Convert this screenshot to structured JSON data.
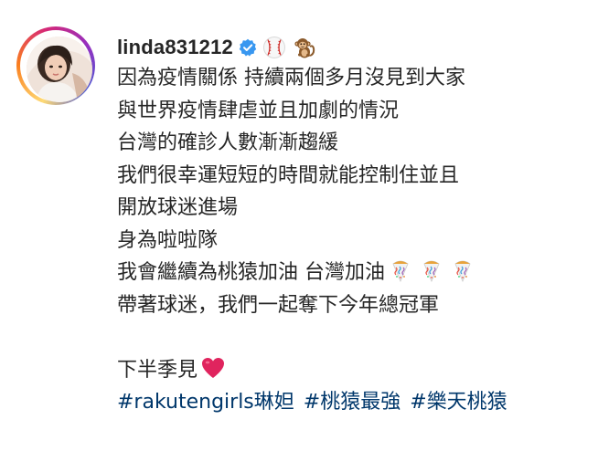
{
  "post": {
    "username": "linda831212",
    "verified": true,
    "header_emojis": [
      "baseball-icon",
      "monkey-icon"
    ],
    "caption_lines": [
      "因為疫情關係 持續兩個多月沒見到大家",
      "與世界疫情肆虐並且加劇的情況",
      "台灣的確診人數漸漸趨緩",
      "我們很幸運短短的時間就能控制住並且",
      "開放球迷進場",
      "身為啦啦隊",
      "我會繼續為桃猿加油 台灣加油",
      "帶著球迷，我們一起奪下今年總冠軍",
      "",
      "下半季見"
    ],
    "line7_emojis": [
      "party-popper-icon",
      "party-popper-icon",
      "party-popper-icon"
    ],
    "line10_emoji": "red-heart-icon",
    "hashtags": [
      "#rakutengirls琳妲",
      "#桃猿最強",
      "#樂天桃猿"
    ]
  },
  "colors": {
    "text": "#262626",
    "hashtag": "#00376b",
    "verified_badge": "#3897f0",
    "heart": "#e0245e"
  }
}
